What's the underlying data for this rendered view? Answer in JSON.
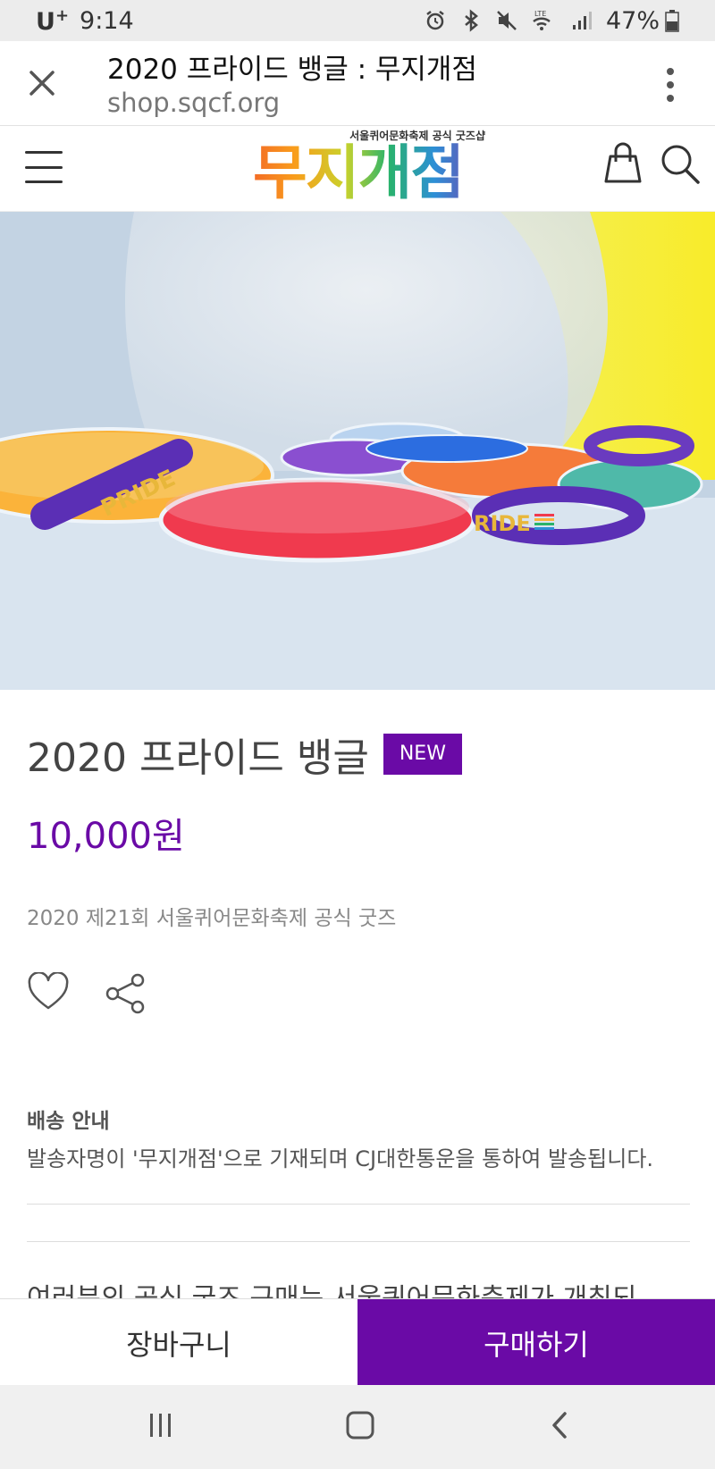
{
  "status_bar": {
    "carrier": "U",
    "carrier_sup": "+",
    "time": "9:14",
    "battery": "47%",
    "network_label": "LTE"
  },
  "browser": {
    "tab_title": "2020 프라이드 뱅글 : 무지개점",
    "url": "shop.sqcf.org"
  },
  "site": {
    "logo_subtitle": "서울퀴어문화축제 공식 굿즈샵",
    "logo_text": "무지개점"
  },
  "product": {
    "title": "2020 프라이드 뱅글",
    "badge": "NEW",
    "price": "10,000원",
    "description": "2020 제21회 서울퀴어문화축제 공식 굿즈",
    "hero_band_text": "PRIDE",
    "hero_band_text_2": "RIDE"
  },
  "shipping": {
    "title": "배송 안내",
    "text": "발송자명이 '무지개점'으로 기재되며 CJ대한통운을 통하여 발송됩니다."
  },
  "partial_text": "여러분의 공식 굿즈 구매는 서울퀴어문화축제가 개최되",
  "actions": {
    "cart": "장바구니",
    "buy": "구매하기"
  },
  "colors": {
    "accent": "#6a0aa6"
  }
}
